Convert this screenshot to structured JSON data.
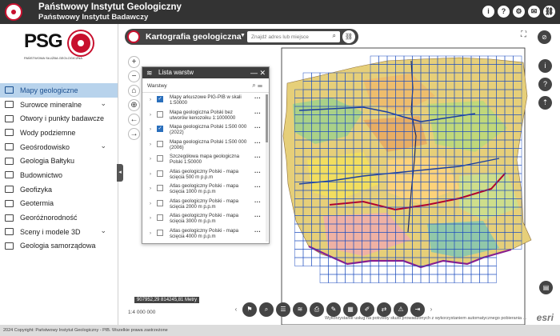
{
  "header": {
    "title": "Państwowy Instytut Geologiczny",
    "subtitle": "Państwowy Instytut Badawczy",
    "icons": [
      "info-icon",
      "help-icon",
      "settings-icon",
      "mail-icon",
      "link-icon"
    ],
    "brand_color": "#c8102e",
    "bar_color": "#333333"
  },
  "logo": {
    "letters": "PSG",
    "caption": "PAŃSTWOWA SŁUŻBA GEOLOGICZNA"
  },
  "sidebar": {
    "items": [
      {
        "label": "Mapy geologiczne",
        "active": true,
        "expandable": false
      },
      {
        "label": "Surowce mineralne",
        "active": false,
        "expandable": true
      },
      {
        "label": "Otwory i punkty badawcze",
        "active": false,
        "expandable": false
      },
      {
        "label": "Wody podziemne",
        "active": false,
        "expandable": false
      },
      {
        "label": "Geośrodowisko",
        "active": false,
        "expandable": true
      },
      {
        "label": "Geologia Bałtyku",
        "active": false,
        "expandable": false
      },
      {
        "label": "Budownictwo",
        "active": false,
        "expandable": false
      },
      {
        "label": "Geofizyka",
        "active": false,
        "expandable": false
      },
      {
        "label": "Geotermia",
        "active": false,
        "expandable": false
      },
      {
        "label": "Georóżnorodność",
        "active": false,
        "expandable": false
      },
      {
        "label": "Sceny i modele 3D",
        "active": false,
        "expandable": true
      },
      {
        "label": "Geologia samorządowa",
        "active": false,
        "expandable": false
      }
    ]
  },
  "search": {
    "app_title": "Kartografia geologiczna",
    "placeholder": "Znajdź adres lub miejsce"
  },
  "layer_panel": {
    "title": "Lista warstw",
    "tab": "Warstwy",
    "layers": [
      {
        "name": "Mapy arkuszowe PIG-PIB w skali 1:50000",
        "checked": true
      },
      {
        "name": "Mapa geologiczna Polski bez utworów kenozoiku 1:1000000",
        "checked": false
      },
      {
        "name": "Mapa geologiczna Polski 1:500 000 (2022)",
        "checked": true
      },
      {
        "name": "Mapa geologiczna Polski 1:500 000 (2006)",
        "checked": false
      },
      {
        "name": "Szczegółowa mapa geologiczna Polski 1:50000",
        "checked": false
      },
      {
        "name": "Atlas geologiczny Polski - mapa ścięcia 500 m p.p.m",
        "checked": false
      },
      {
        "name": "Atlas geologiczny Polski - mapa ścięcia 1000 m p.p.m",
        "checked": false
      },
      {
        "name": "Atlas geologiczny Polski - mapa ścięcia 2000 m p.p.m",
        "checked": false
      },
      {
        "name": "Atlas geologiczny Polski - mapa ścięcia 3000 m p.p.m",
        "checked": false
      },
      {
        "name": "Atlas geologiczny Polski - mapa ścięcia 4000 m p.p.m",
        "checked": false
      }
    ]
  },
  "map": {
    "coordinates": "907952,29 814245,81 Metry",
    "scale": "1:4 000 000",
    "attribution": "Wykorzystanie usług na potrzeby służb prowadzonych z wykorzystaniem automatycznego pobierania ...",
    "esri_label": "esri",
    "grid_color": "#1f4fbf"
  },
  "footer": {
    "text": "2024 Copyright: Państwowy Instytut Geologiczny - PIB. Wszelkie prawa zastrzeżone"
  }
}
